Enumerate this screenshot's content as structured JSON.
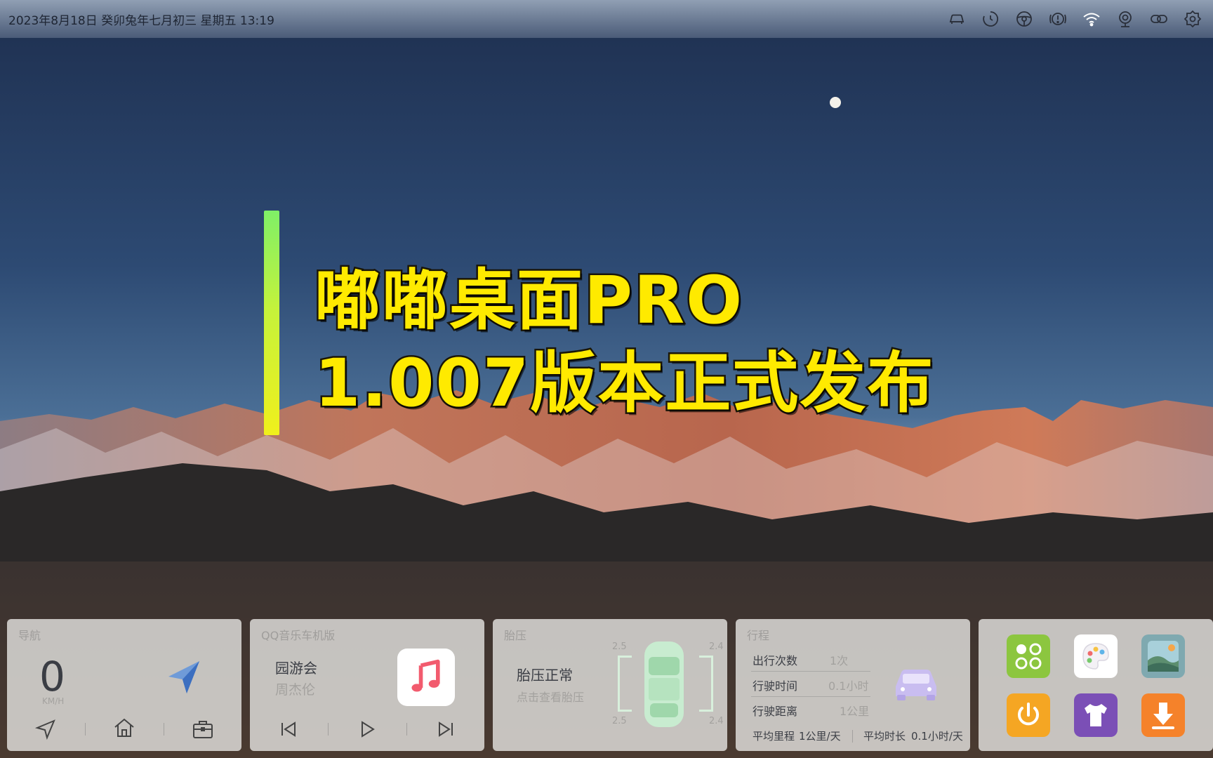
{
  "status_bar": {
    "datetime": "2023年8月18日  癸卯兔年七月初三  星期五  13:19",
    "icons": [
      "car-icon",
      "timer-icon",
      "steering-wheel-icon",
      "warning-icon",
      "wifi-icon",
      "camera-icon",
      "link-icon",
      "settings-icon"
    ]
  },
  "banner": {
    "line1": "嘟嘟桌面PRO",
    "line2": "1.007版本正式发布"
  },
  "nav_card": {
    "title": "导航",
    "speed": "0",
    "speed_unit": "KM/H",
    "icons": [
      "navigate-icon",
      "home-icon",
      "briefcase-icon"
    ]
  },
  "music_card": {
    "title": "QQ音乐车机版",
    "song": "园游会",
    "artist": "周杰伦",
    "icons": [
      "previous-icon",
      "play-icon",
      "next-icon"
    ]
  },
  "tire_card": {
    "title": "胎压",
    "status": "胎压正常",
    "subtitle": "点击查看胎压",
    "values": [
      "2.5",
      "2.4",
      "2.5",
      "2.4"
    ]
  },
  "trip_card": {
    "title": "行程",
    "rows": [
      {
        "label": "出行次数",
        "value": "1次"
      },
      {
        "label": "行驶时间",
        "value": "0.1小时"
      },
      {
        "label": "行驶距离",
        "value": "1公里"
      }
    ],
    "foot_left_label": "平均里程",
    "foot_left_value": "1公里/天",
    "foot_right_label": "平均时长",
    "foot_right_value": "0.1小时/天"
  },
  "apps": [
    {
      "name": "app-grid-icon",
      "color": "#8cc63f"
    },
    {
      "name": "palette-icon",
      "color": "#ffffff"
    },
    {
      "name": "wallpaper-icon",
      "color": "#7fa9b0"
    },
    {
      "name": "power-icon",
      "color": "#f5a623"
    },
    {
      "name": "tshirt-icon",
      "color": "#7b4fb6"
    },
    {
      "name": "download-icon",
      "color": "#f5822a"
    }
  ],
  "colors": {
    "headline": "#ffea00",
    "accent_bar_top": "#7ff067",
    "accent_bar_bottom": "#f0f01c"
  }
}
